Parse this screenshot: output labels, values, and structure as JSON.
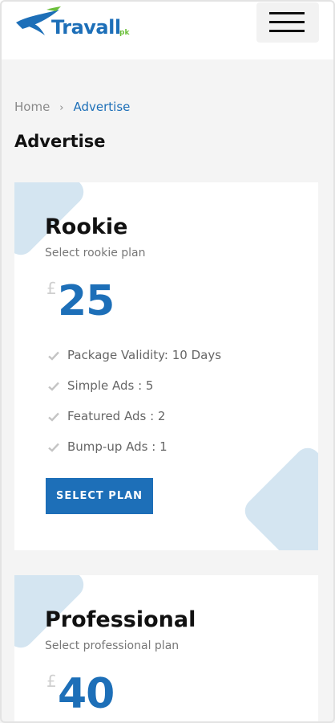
{
  "header": {
    "logo_text": "Travall",
    "logo_sub": "pk"
  },
  "breadcrumb": {
    "home": "Home",
    "separator": "›",
    "current": "Advertise"
  },
  "page_title": "Advertise",
  "plans": [
    {
      "name": "Rookie",
      "subtitle": "Select  rookie plan",
      "currency": "£",
      "price": "25",
      "features": [
        "Package Validity: 10 Days",
        "Simple Ads : 5",
        "Featured Ads : 2",
        "Bump-up Ads : 1"
      ],
      "button_label": "SELECT PLAN"
    },
    {
      "name": "Professional",
      "subtitle": "Select professional plan",
      "currency": "£",
      "price": "40"
    }
  ],
  "colors": {
    "accent": "#1d6fb8",
    "logo_green": "#6bbf3a",
    "decor": "#d4e5f1"
  },
  "icons": [
    "hamburger-menu-icon",
    "check-icon",
    "plane-logo-icon"
  ]
}
